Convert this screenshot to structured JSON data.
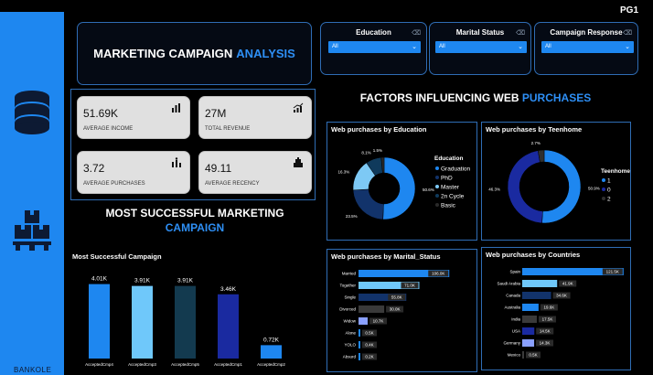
{
  "page": {
    "label": "PG1",
    "author": "BANKOLE"
  },
  "title": {
    "part1": "MARKETING CAMPAIGN",
    "part2": "ANALYSIS"
  },
  "slicers": [
    {
      "label": "Education",
      "value": "All"
    },
    {
      "label": "Marital Status",
      "value": "All"
    },
    {
      "label": "Campaign Response",
      "value": "All"
    }
  ],
  "kpis": [
    {
      "value": "51.69K",
      "caption": "AVERAGE INCOME",
      "icon": "bar-chart-icon"
    },
    {
      "value": "27M",
      "caption": "TOTAL REVENUE",
      "icon": "trend-chart-icon"
    },
    {
      "value": "3.72",
      "caption": "AVERAGE PURCHASES",
      "icon": "purchases-icon"
    },
    {
      "value": "49.11",
      "caption": "AVERAGE RECENCY",
      "icon": "recency-icon"
    }
  ],
  "sections": {
    "campaign_title1": "MOST SUCCESSFUL MARKETING",
    "campaign_title2": "CAMPAIGN",
    "factors_title1": "FACTORS INFLUENCING WEB",
    "factors_title2": "PURCHASES"
  },
  "colors": {
    "accent": "#1e87f0",
    "border": "#2f6db5",
    "bg": "#000000"
  },
  "chart_data": [
    {
      "type": "bar",
      "title": "Most Successful Campaign",
      "categories": [
        "AcceptedCmp4",
        "AcceptedCmp3",
        "AcceptedCmp5",
        "AcceptedCmp1",
        "AcceptedCmp2"
      ],
      "values": [
        4010,
        3910,
        3910,
        3460,
        720
      ],
      "labels": [
        "4.01K",
        "3.91K",
        "3.91K",
        "3.46K",
        "0.72K"
      ],
      "colors": [
        "#1e87f0",
        "#6fc8fa",
        "#133a4f",
        "#1a2aa0",
        "#1e87f0"
      ],
      "ylim": [
        0,
        4500
      ]
    },
    {
      "type": "pie",
      "title": "Web purchases by Education",
      "legend_title": "Education",
      "categories": [
        "Graduation",
        "PhD",
        "Master",
        "2n Cycle",
        "Basic"
      ],
      "values": [
        50.6,
        23.5,
        16.3,
        8.1,
        1.5
      ],
      "labels": [
        "50.6%",
        "23.5%",
        "16.3%",
        "8.1%",
        "1.5%"
      ],
      "colors": [
        "#1e87f0",
        "#12336b",
        "#7dc9f5",
        "#0f3a5c",
        "#2a2a2a"
      ]
    },
    {
      "type": "pie",
      "title": "Web purchases by Teenhome",
      "legend_title": "Teenhome",
      "categories": [
        "1",
        "0",
        "2"
      ],
      "values": [
        50.9,
        46.3,
        2.7
      ],
      "labels": [
        "50.9%",
        "46.3%",
        "2.7%"
      ],
      "colors": [
        "#1e87f0",
        "#1a2aa0",
        "#2f2f2f"
      ]
    },
    {
      "type": "bar",
      "orientation": "horizontal",
      "title": "Web purchases by Marital_Status",
      "categories": [
        "Married",
        "Together",
        "Single",
        "Divorced",
        "Widow",
        "Alone",
        "YOLO",
        "Absurd"
      ],
      "values": [
        106.0,
        71.0,
        55.8,
        30.0,
        10.7,
        0.5,
        0.4,
        0.2
      ],
      "labels": [
        "106.0K",
        "71.0K",
        "55.8K",
        "30.0K",
        "10.7K",
        "0.5K",
        "0.4K",
        "0.2K"
      ],
      "colors": [
        "#1e87f0",
        "#6fc8fa",
        "#12336b",
        "#3a3a3a",
        "#8aa0ff",
        "#1e87f0",
        "#1e87f0",
        "#1e87f0"
      ],
      "xlim": [
        0,
        110
      ]
    },
    {
      "type": "bar",
      "orientation": "horizontal",
      "title": "Web purchases by Countries",
      "categories": [
        "Spain",
        "Saudi Arabia",
        "Canada",
        "Australia",
        "India",
        "USA",
        "Germany",
        "Mexico"
      ],
      "values": [
        121.5,
        41.9,
        34.6,
        19.6,
        17.5,
        14.5,
        14.3,
        0.5
      ],
      "labels": [
        "121.5K",
        "41.9K",
        "34.6K",
        "19.6K",
        "17.5K",
        "14.5K",
        "14.3K",
        "0.5K"
      ],
      "colors": [
        "#1e87f0",
        "#6fc8fa",
        "#12336b",
        "#1e87f0",
        "#3a3a3a",
        "#1a2aa0",
        "#8aa0ff",
        "#3a3a3a"
      ],
      "xlim": [
        0,
        125
      ]
    }
  ]
}
